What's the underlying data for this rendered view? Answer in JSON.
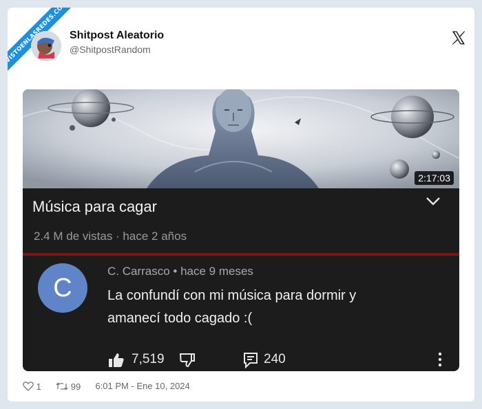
{
  "watermark": "VISTOENLASREDES.COM",
  "author": {
    "name": "Shitpost Aleatorio",
    "handle": "@ShitpostRandom"
  },
  "video": {
    "duration": "2:17:03",
    "title": "Música para cagar",
    "meta": "2.4 M de vistas · hace 2 años"
  },
  "comment": {
    "avatar_letter": "C",
    "meta": "C. Carrasco • hace 9 meses",
    "line1": "La confundí con mi música para dormir y",
    "line2": "amanecí todo cagado :(",
    "likes": "7,519",
    "replies": "240"
  },
  "footer": {
    "likes": "1",
    "retweets": "99",
    "timestamp": "6:01 PM - Ene 10, 2024"
  },
  "colors": {
    "accent": "#1d8fe1",
    "comment_avatar": "#5f84c7",
    "divider": "#7e1414"
  }
}
